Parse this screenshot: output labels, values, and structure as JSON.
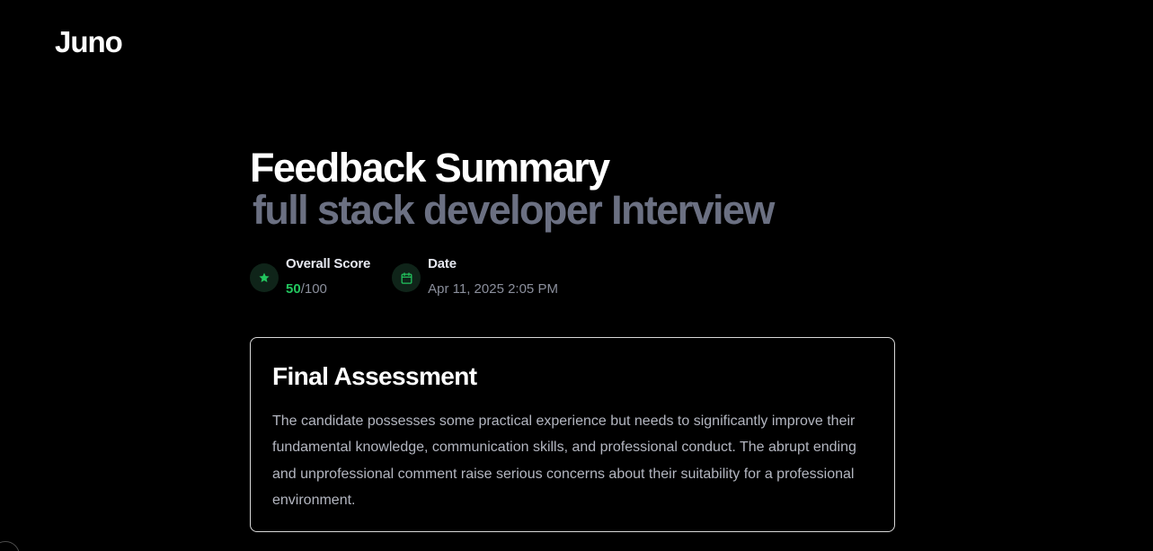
{
  "header": {
    "logo_text": "Juno"
  },
  "main": {
    "title": "Feedback Summary",
    "subtitle": "full stack developer Interview",
    "score": {
      "label": "Overall Score",
      "value": "50",
      "max": "/100",
      "icon": "star-icon"
    },
    "date": {
      "label": "Date",
      "value": "Apr 11, 2025 2:05 PM",
      "icon": "calendar-icon"
    }
  },
  "assessment": {
    "title": "Final Assessment",
    "body": "The candidate possesses some practical experience but needs to significantly improve their fundamental knowledge, communication skills, and professional conduct. The abrupt ending and unprofessional comment raise serious concerns about their suitability for a professional environment."
  },
  "colors": {
    "background": "#000000",
    "accent_green": "#22c55e",
    "subtitle_gray": "#6b7082",
    "card_border": "#d8d8d8"
  }
}
